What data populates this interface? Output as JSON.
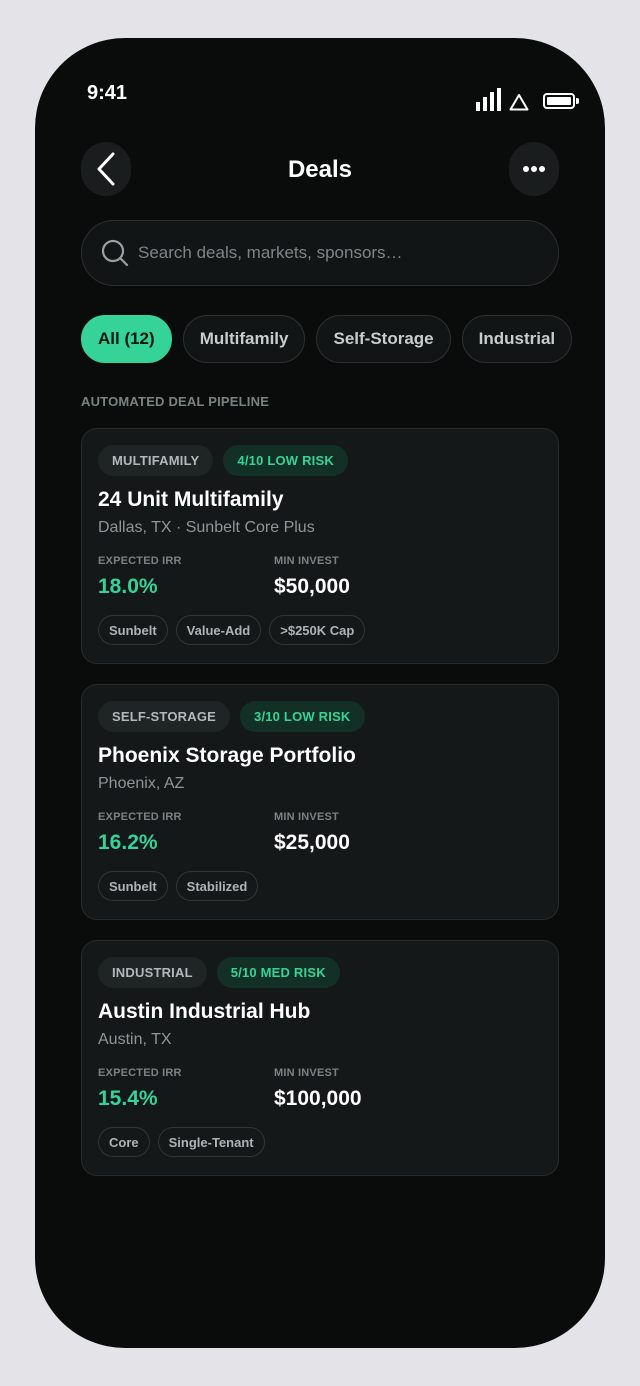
{
  "status": {
    "time": "9:41"
  },
  "header": {
    "title": "Deals"
  },
  "search": {
    "placeholder": "Search deals, markets, sponsors…"
  },
  "filters": [
    {
      "label": "All (12)",
      "active": true
    },
    {
      "label": "Multifamily",
      "active": false
    },
    {
      "label": "Self-Storage",
      "active": false
    },
    {
      "label": "Industrial",
      "active": false
    }
  ],
  "section": {
    "label": "AUTOMATED DEAL PIPELINE"
  },
  "metric_labels": {
    "irr": "EXPECTED IRR",
    "min": "MIN INVEST"
  },
  "deals": [
    {
      "type": "MULTIFAMILY",
      "risk": "4/10 LOW RISK",
      "name": "24 Unit Multifamily",
      "location": "Dallas, TX · Sunbelt Core Plus",
      "irr": "18.0%",
      "min_invest": "$50,000",
      "tags": [
        "Sunbelt",
        "Value-Add",
        ">$250K Cap"
      ]
    },
    {
      "type": "SELF-STORAGE",
      "risk": "3/10 LOW RISK",
      "name": "Phoenix Storage Portfolio",
      "location": "Phoenix, AZ",
      "irr": "16.2%",
      "min_invest": "$25,000",
      "tags": [
        "Sunbelt",
        "Stabilized"
      ]
    },
    {
      "type": "INDUSTRIAL",
      "risk": "5/10 MED RISK",
      "name": "Austin Industrial Hub",
      "location": "Austin, TX",
      "irr": "15.4%",
      "min_invest": "$100,000",
      "tags": [
        "Core",
        "Single-Tenant"
      ]
    }
  ],
  "colors": {
    "accent": "#36d399",
    "background": "#0a0c0c",
    "card": "#141819"
  }
}
